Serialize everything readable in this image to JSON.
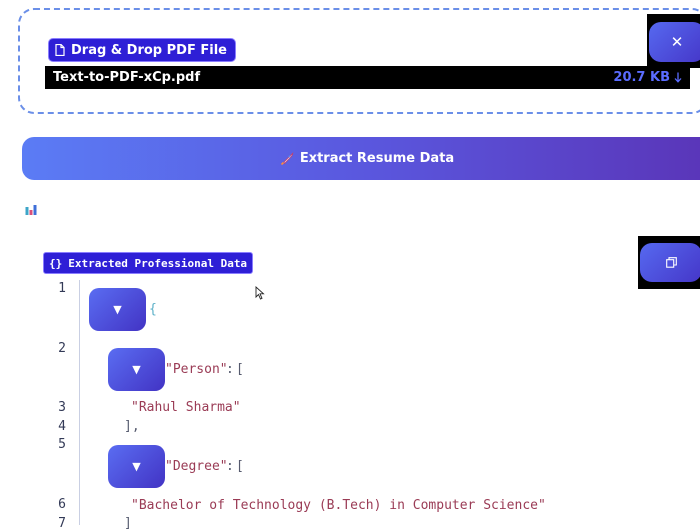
{
  "upload": {
    "label": "Drag & Drop PDF File",
    "file_name": "Text-to-PDF-xCp.pdf",
    "file_size": "20.7 KB",
    "close_symbol": "✕"
  },
  "extract_button": {
    "label": "Extract Resume Data",
    "icon": "rocket-icon"
  },
  "section": {
    "label": "Extracted Professional Data",
    "icon_text": "{}"
  },
  "editor": {
    "toggle_symbol": "▼",
    "line_numbers": [
      "1",
      "2",
      "3",
      "4",
      "5",
      "6",
      "7"
    ],
    "lines": {
      "open_brace": "{",
      "person_key": "\"Person\"",
      "colon": ":",
      "open_bracket": "[",
      "person_value": "\"Rahul Sharma\"",
      "close_bracket_comma": "],",
      "degree_key": "\"Degree\"",
      "degree_value": "\"Bachelor of Technology (B.Tech) in Computer Science\"",
      "close_bracket": "]"
    }
  },
  "colors": {
    "accent": "#2e1fd6",
    "gradient_start": "#5b7cf5",
    "gradient_end": "#5a35b8"
  }
}
